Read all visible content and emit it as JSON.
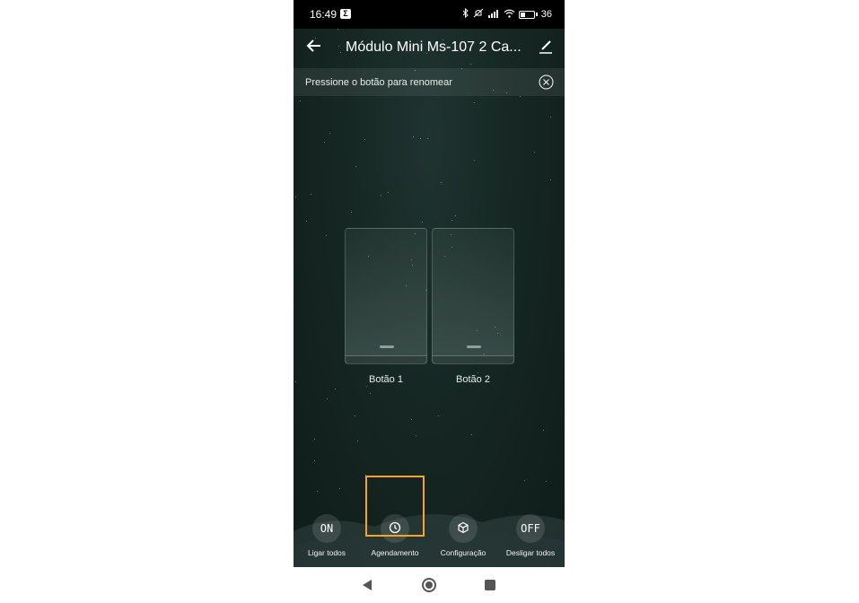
{
  "status_bar": {
    "time": "16:49",
    "app_icon_letter": "Σ",
    "battery_text": "36",
    "battery_percent": 36
  },
  "header": {
    "title": "Módulo Mini Ms-107 2 Ca...",
    "back_icon": "arrow-left-icon",
    "edit_icon": "pencil-icon"
  },
  "banner": {
    "text": "Pressione o botão para renomear",
    "close_icon": "close-circle-icon"
  },
  "switches": [
    {
      "label": "Botão 1"
    },
    {
      "label": "Botão 2"
    }
  ],
  "actions": [
    {
      "label": "Ligar todos",
      "glyph": "ON",
      "icon": "on-icon"
    },
    {
      "label": "Agendamento",
      "glyph": "",
      "icon": "clock-icon"
    },
    {
      "label": "Configuração",
      "glyph": "",
      "icon": "cube-icon"
    },
    {
      "label": "Desligar todos",
      "glyph": "OFF",
      "icon": "off-icon"
    }
  ],
  "colors": {
    "highlight": "#f5a42a",
    "background": "#162723"
  }
}
